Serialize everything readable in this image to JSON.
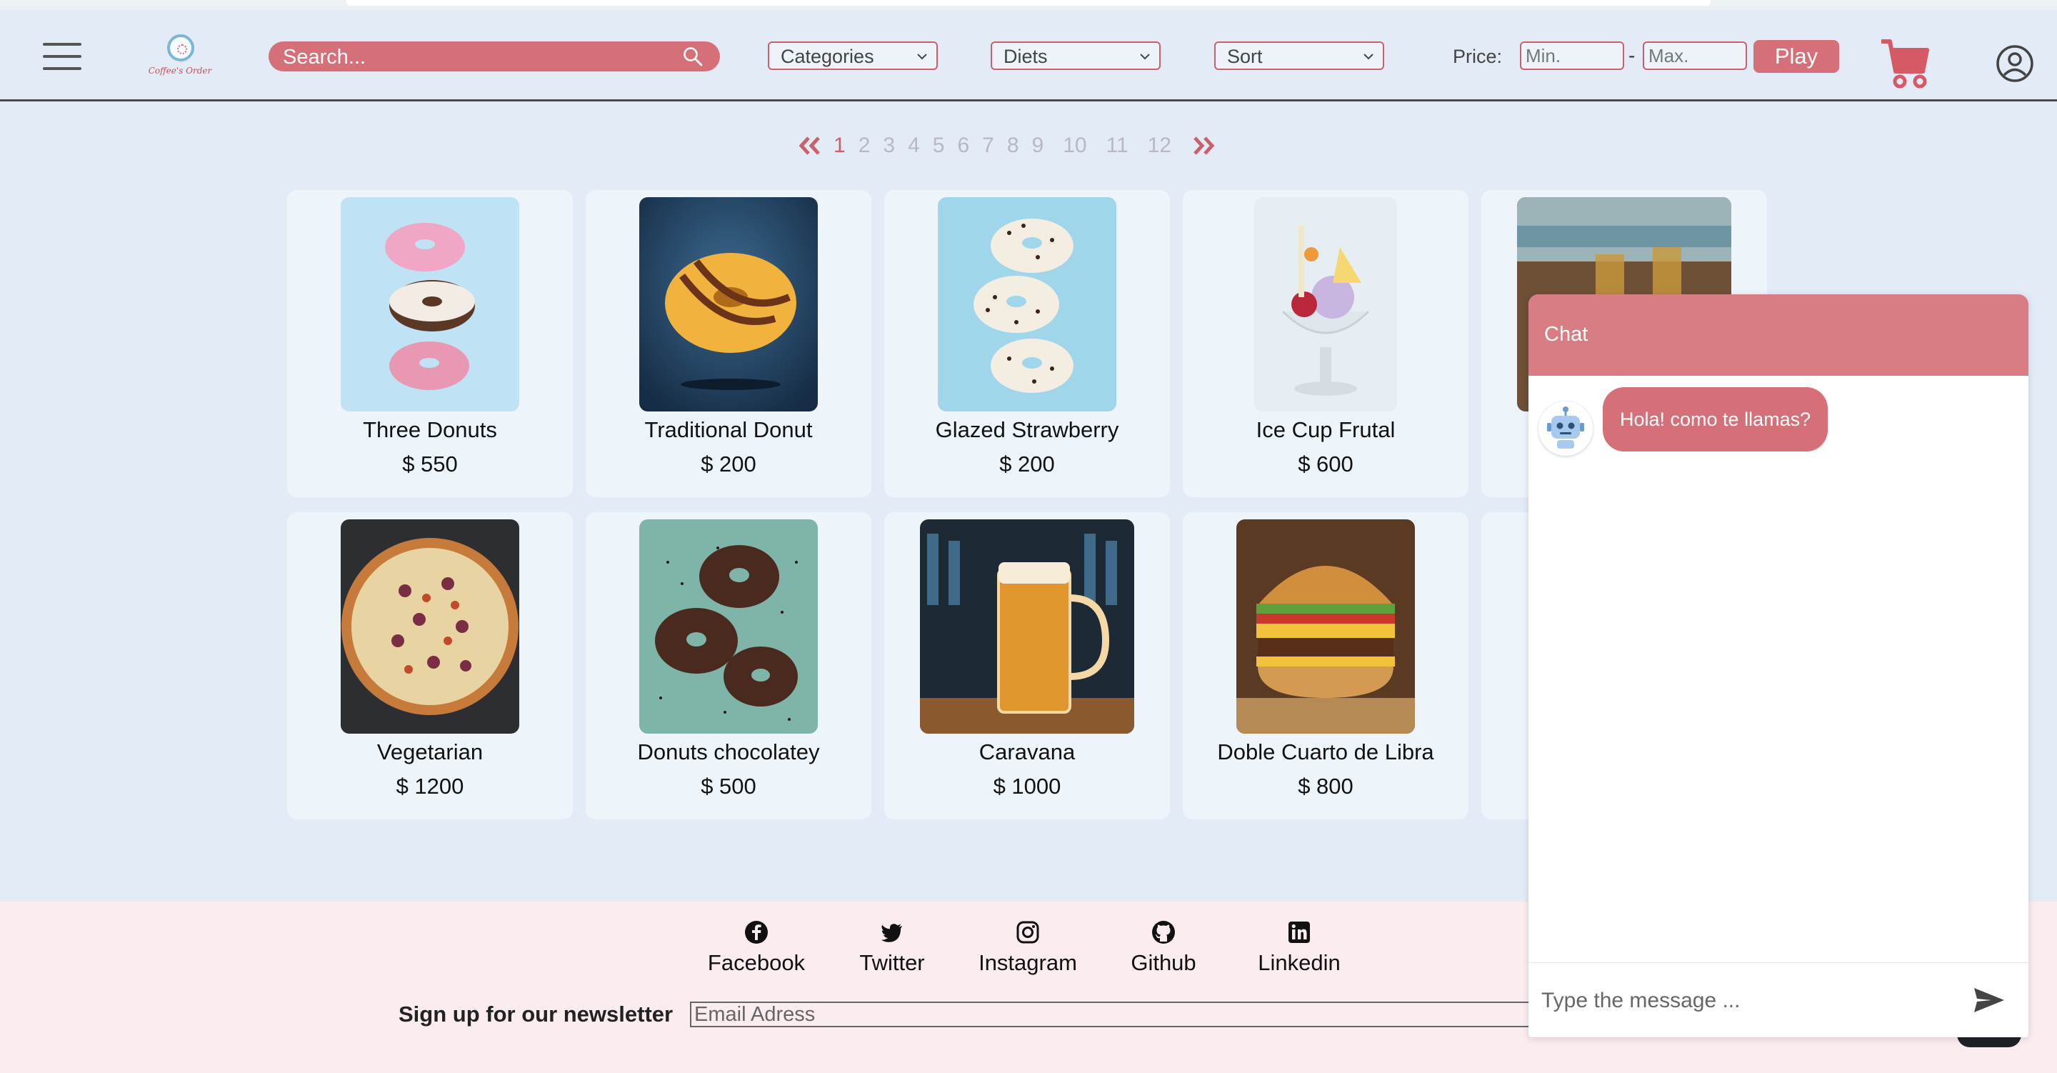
{
  "header": {
    "logo_text": "Coffee's Order",
    "search_placeholder": "Search...",
    "filters": [
      {
        "label": "Categories"
      },
      {
        "label": "Diets"
      },
      {
        "label": "Sort"
      }
    ],
    "price_label": "Price:",
    "price_min_placeholder": "Min.",
    "price_max_placeholder": "Max.",
    "price_separator": "-",
    "play_label": "Play"
  },
  "pagination": {
    "pages": [
      "1",
      "2",
      "3",
      "4",
      "5",
      "6",
      "7",
      "8",
      "9",
      "10",
      "11",
      "12"
    ],
    "current": "1"
  },
  "products": [
    {
      "name": "Three Donuts",
      "price": "$ 550"
    },
    {
      "name": "Traditional Donut",
      "price": "$ 200"
    },
    {
      "name": "Glazed Strawberry",
      "price": "$ 200"
    },
    {
      "name": "Ice Cup Frutal",
      "price": "$ 600"
    },
    {
      "name": "",
      "price": ""
    },
    {
      "name": "Vegetarian",
      "price": "$ 1200"
    },
    {
      "name": "Donuts chocolatey",
      "price": "$ 500"
    },
    {
      "name": "Caravana",
      "price": "$ 1000"
    },
    {
      "name": "Doble Cuarto de Libra",
      "price": "$ 800"
    },
    {
      "name": "",
      "price": ""
    }
  ],
  "footer": {
    "social": [
      {
        "label": "Facebook",
        "icon": "facebook-icon"
      },
      {
        "label": "Twitter",
        "icon": "twitter-icon"
      },
      {
        "label": "Instagram",
        "icon": "instagram-icon"
      },
      {
        "label": "Github",
        "icon": "github-icon"
      },
      {
        "label": "Linkedin",
        "icon": "linkedin-icon"
      }
    ],
    "newsletter_label": "Sign up for our newsletter",
    "email_placeholder": "Email Adress"
  },
  "chat": {
    "title": "Chat",
    "messages": [
      {
        "from": "bot",
        "text": "Hola! como te llamas?"
      }
    ],
    "input_placeholder": "Type the message ..."
  },
  "colors": {
    "accent": "#d56f78",
    "background": "#e3ecf6",
    "footer_bg": "#fbecef",
    "chat_header": "#d97d84"
  }
}
